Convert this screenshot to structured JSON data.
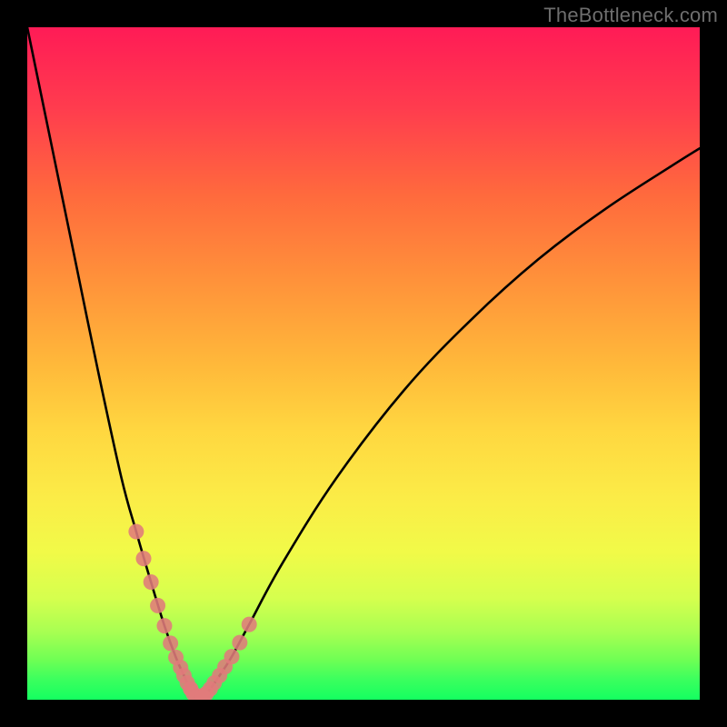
{
  "attribution": "TheBottleneck.com",
  "chart_data": {
    "type": "line",
    "title": "",
    "xlabel": "",
    "ylabel": "",
    "xlim": [
      0,
      100
    ],
    "ylim": [
      0,
      100
    ],
    "grid": false,
    "series": [
      {
        "name": "bottleneck-curve",
        "color": "#000000",
        "x": [
          0,
          3.5,
          7,
          10.5,
          14,
          16.2,
          18.4,
          20.4,
          22.1,
          23.3,
          24.3,
          25.2,
          26.1,
          27.2,
          28.6,
          30.4,
          33,
          38,
          46,
          56,
          66,
          76,
          86,
          96,
          100
        ],
        "y": [
          100,
          83,
          66,
          49,
          33,
          25,
          17.5,
          11,
          6.3,
          3.6,
          1.6,
          0.5,
          0.5,
          1.6,
          3.6,
          6.4,
          11.2,
          20.4,
          33,
          46,
          56.5,
          65.5,
          73,
          79.5,
          82
        ]
      },
      {
        "name": "marker-dots-left",
        "color": "#e07b7b",
        "type": "scatter",
        "x": [
          16.2,
          17.3,
          18.4,
          19.4,
          20.4,
          21.3,
          22.1,
          22.8,
          23.3,
          23.8,
          24.3
        ],
        "y": [
          25,
          21,
          17.5,
          14,
          11,
          8.4,
          6.3,
          4.8,
          3.6,
          2.5,
          1.6
        ]
      },
      {
        "name": "marker-dots-right",
        "color": "#e07b7b",
        "type": "scatter",
        "x": [
          26.1,
          26.6,
          27.2,
          27.8,
          28.6,
          29.4,
          30.4,
          31.6,
          33
        ],
        "y": [
          0.5,
          0.9,
          1.6,
          2.5,
          3.6,
          4.9,
          6.4,
          8.5,
          11.2
        ]
      },
      {
        "name": "marker-dots-bottom",
        "color": "#e07b7b",
        "type": "scatter",
        "x": [
          24.3,
          24.7,
          25.2,
          25.7,
          26.1
        ],
        "y": [
          1.6,
          0.9,
          0.5,
          0.5,
          0.5
        ]
      }
    ],
    "gradient_map": {
      "orientation": "vertical",
      "high_y_color": "#ff1b56",
      "mid_y_color": "#ffd740",
      "low_y_color": "#14ff60"
    }
  }
}
